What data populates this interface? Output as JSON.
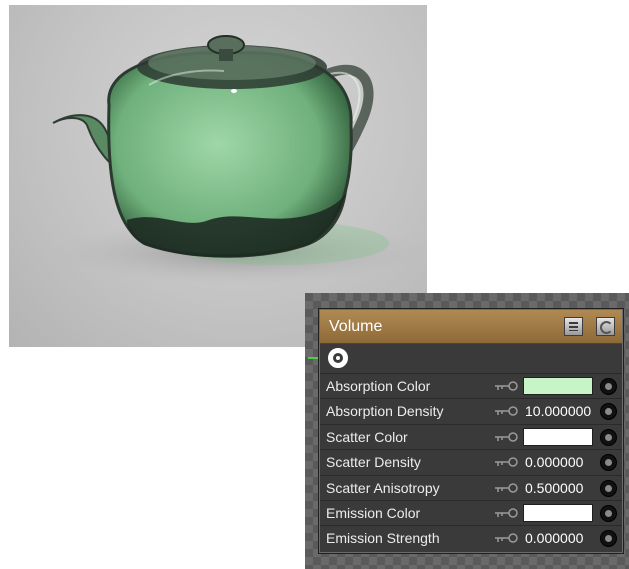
{
  "render": {
    "image_name": "teapot-volume-render"
  },
  "node": {
    "title": "Volume",
    "output_connector_icon": "output-socket-icon",
    "header_buttons": [
      "list-icon",
      "cycle-icon"
    ],
    "properties": [
      {
        "label": "Absorption Color",
        "type": "color",
        "value": "",
        "color": "#c8f5c8"
      },
      {
        "label": "Absorption Density",
        "type": "number",
        "value": "10.000000"
      },
      {
        "label": "Scatter Color",
        "type": "color",
        "value": "",
        "color": "#ffffff"
      },
      {
        "label": "Scatter Density",
        "type": "number",
        "value": "0.000000"
      },
      {
        "label": "Scatter Anisotropy",
        "type": "number",
        "value": "0.500000"
      },
      {
        "label": "Emission Color",
        "type": "color",
        "value": "",
        "color": "#ffffff"
      },
      {
        "label": "Emission Strength",
        "type": "number",
        "value": "0.000000"
      }
    ]
  },
  "colors": {
    "header": "#9e7a46",
    "wire": "#4bd04b",
    "panel": "#3a3a3a"
  }
}
